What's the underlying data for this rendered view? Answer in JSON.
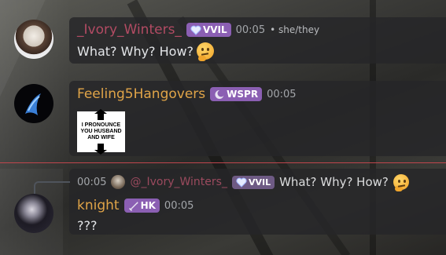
{
  "messages": [
    {
      "username": "_Ivory_Winters_",
      "name_color": "#b24b63",
      "tag": "VVIL",
      "tag_icon": "heart-icon",
      "time": "00:05",
      "pronouns": "• she/they",
      "text": "What? Why? How?",
      "emoji": "thinking-face"
    },
    {
      "username": "Feeling5Hangovers",
      "name_color": "#e0a448",
      "tag": "WSPR",
      "tag_icon": "moon-icon",
      "time": "00:05",
      "image_text": "I PRONOUNCE YOU HUSBAND AND WIFE"
    },
    {
      "reply": {
        "time": "00:05",
        "username": "@_Ivory_Winters_",
        "tag": "VVIL",
        "text": "What? Why? How?"
      },
      "username": "knight",
      "name_color": "#e0a448",
      "tag": "HK",
      "tag_icon": "sword-icon",
      "time": "00:05",
      "text": "???"
    }
  ],
  "colors": {
    "tag_bg": "#8b5fb3",
    "divider": "#c0464d"
  }
}
